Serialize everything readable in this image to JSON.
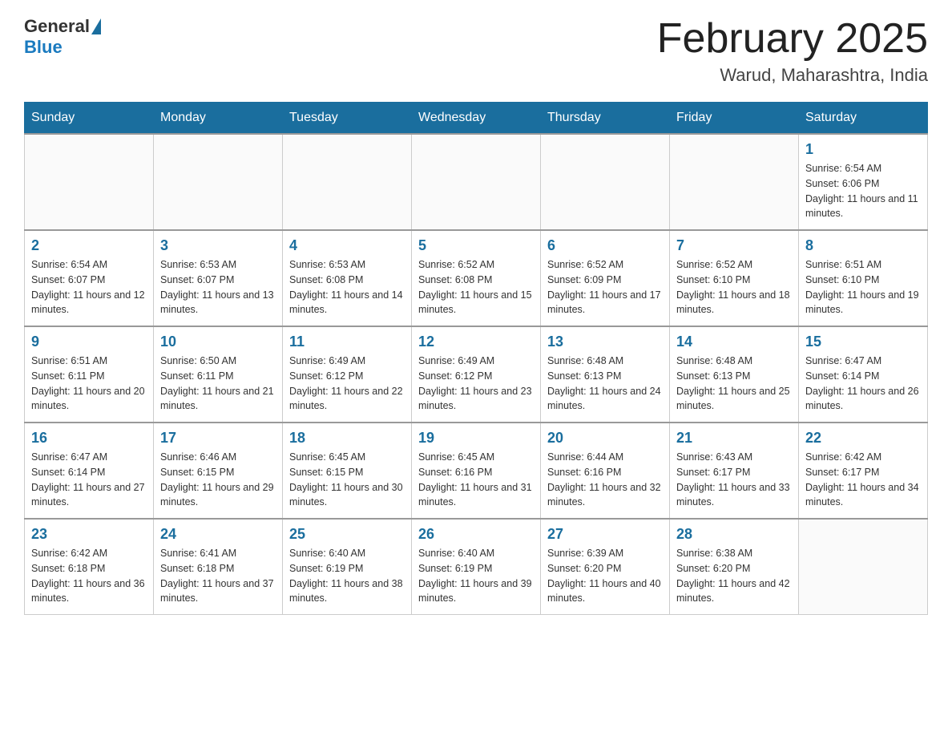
{
  "header": {
    "logo_general": "General",
    "logo_blue": "Blue",
    "month_title": "February 2025",
    "location": "Warud, Maharashtra, India"
  },
  "days_of_week": [
    "Sunday",
    "Monday",
    "Tuesday",
    "Wednesday",
    "Thursday",
    "Friday",
    "Saturday"
  ],
  "weeks": [
    [
      {
        "day": "",
        "info": ""
      },
      {
        "day": "",
        "info": ""
      },
      {
        "day": "",
        "info": ""
      },
      {
        "day": "",
        "info": ""
      },
      {
        "day": "",
        "info": ""
      },
      {
        "day": "",
        "info": ""
      },
      {
        "day": "1",
        "info": "Sunrise: 6:54 AM\nSunset: 6:06 PM\nDaylight: 11 hours and 11 minutes."
      }
    ],
    [
      {
        "day": "2",
        "info": "Sunrise: 6:54 AM\nSunset: 6:07 PM\nDaylight: 11 hours and 12 minutes."
      },
      {
        "day": "3",
        "info": "Sunrise: 6:53 AM\nSunset: 6:07 PM\nDaylight: 11 hours and 13 minutes."
      },
      {
        "day": "4",
        "info": "Sunrise: 6:53 AM\nSunset: 6:08 PM\nDaylight: 11 hours and 14 minutes."
      },
      {
        "day": "5",
        "info": "Sunrise: 6:52 AM\nSunset: 6:08 PM\nDaylight: 11 hours and 15 minutes."
      },
      {
        "day": "6",
        "info": "Sunrise: 6:52 AM\nSunset: 6:09 PM\nDaylight: 11 hours and 17 minutes."
      },
      {
        "day": "7",
        "info": "Sunrise: 6:52 AM\nSunset: 6:10 PM\nDaylight: 11 hours and 18 minutes."
      },
      {
        "day": "8",
        "info": "Sunrise: 6:51 AM\nSunset: 6:10 PM\nDaylight: 11 hours and 19 minutes."
      }
    ],
    [
      {
        "day": "9",
        "info": "Sunrise: 6:51 AM\nSunset: 6:11 PM\nDaylight: 11 hours and 20 minutes."
      },
      {
        "day": "10",
        "info": "Sunrise: 6:50 AM\nSunset: 6:11 PM\nDaylight: 11 hours and 21 minutes."
      },
      {
        "day": "11",
        "info": "Sunrise: 6:49 AM\nSunset: 6:12 PM\nDaylight: 11 hours and 22 minutes."
      },
      {
        "day": "12",
        "info": "Sunrise: 6:49 AM\nSunset: 6:12 PM\nDaylight: 11 hours and 23 minutes."
      },
      {
        "day": "13",
        "info": "Sunrise: 6:48 AM\nSunset: 6:13 PM\nDaylight: 11 hours and 24 minutes."
      },
      {
        "day": "14",
        "info": "Sunrise: 6:48 AM\nSunset: 6:13 PM\nDaylight: 11 hours and 25 minutes."
      },
      {
        "day": "15",
        "info": "Sunrise: 6:47 AM\nSunset: 6:14 PM\nDaylight: 11 hours and 26 minutes."
      }
    ],
    [
      {
        "day": "16",
        "info": "Sunrise: 6:47 AM\nSunset: 6:14 PM\nDaylight: 11 hours and 27 minutes."
      },
      {
        "day": "17",
        "info": "Sunrise: 6:46 AM\nSunset: 6:15 PM\nDaylight: 11 hours and 29 minutes."
      },
      {
        "day": "18",
        "info": "Sunrise: 6:45 AM\nSunset: 6:15 PM\nDaylight: 11 hours and 30 minutes."
      },
      {
        "day": "19",
        "info": "Sunrise: 6:45 AM\nSunset: 6:16 PM\nDaylight: 11 hours and 31 minutes."
      },
      {
        "day": "20",
        "info": "Sunrise: 6:44 AM\nSunset: 6:16 PM\nDaylight: 11 hours and 32 minutes."
      },
      {
        "day": "21",
        "info": "Sunrise: 6:43 AM\nSunset: 6:17 PM\nDaylight: 11 hours and 33 minutes."
      },
      {
        "day": "22",
        "info": "Sunrise: 6:42 AM\nSunset: 6:17 PM\nDaylight: 11 hours and 34 minutes."
      }
    ],
    [
      {
        "day": "23",
        "info": "Sunrise: 6:42 AM\nSunset: 6:18 PM\nDaylight: 11 hours and 36 minutes."
      },
      {
        "day": "24",
        "info": "Sunrise: 6:41 AM\nSunset: 6:18 PM\nDaylight: 11 hours and 37 minutes."
      },
      {
        "day": "25",
        "info": "Sunrise: 6:40 AM\nSunset: 6:19 PM\nDaylight: 11 hours and 38 minutes."
      },
      {
        "day": "26",
        "info": "Sunrise: 6:40 AM\nSunset: 6:19 PM\nDaylight: 11 hours and 39 minutes."
      },
      {
        "day": "27",
        "info": "Sunrise: 6:39 AM\nSunset: 6:20 PM\nDaylight: 11 hours and 40 minutes."
      },
      {
        "day": "28",
        "info": "Sunrise: 6:38 AM\nSunset: 6:20 PM\nDaylight: 11 hours and 42 minutes."
      },
      {
        "day": "",
        "info": ""
      }
    ]
  ]
}
